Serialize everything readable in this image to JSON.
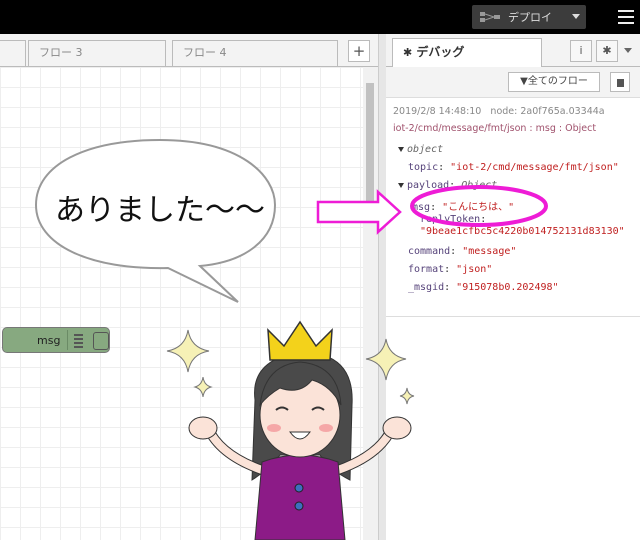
{
  "header": {
    "deploy_label": "デプロイ"
  },
  "workspace": {
    "tabs": [
      "フロー 3",
      "フロー 4"
    ],
    "add_tab": "+",
    "node_label": "msg"
  },
  "sidebar": {
    "tab_title": "デバッグ",
    "info_label": "i",
    "filter_label": "全てのフロー",
    "message": {
      "timestamp": "2019/2/8 14:48:10",
      "node": "node: 2a0f765a.03344a",
      "topic_path": "iot-2/cmd/message/fmt/json : msg : Object",
      "root": "object",
      "topic_key": "topic",
      "topic_val": "\"iot-2/cmd/message/fmt/json\"",
      "payload_key": "payload",
      "payload_type": "Object",
      "msg_key": "msg",
      "msg_val": "\"こんにちは、\"",
      "reply_key": "replyToken",
      "reply_val": "\"9beae1cfbc5c4220b014752131d83130\"",
      "command_key": "command",
      "command_val": "\"message\"",
      "format_key": "format",
      "format_val": "\"json\"",
      "msgid_key": "_msgid",
      "msgid_val": "\"915078b0.202498\""
    }
  },
  "illustration": {
    "speech": "ありました～～"
  },
  "colors": {
    "topbar": "#000000",
    "highlight": "#ee1cd6",
    "node": "#87a980",
    "crown": "#f3d21b",
    "dress": "#8c1b87"
  }
}
